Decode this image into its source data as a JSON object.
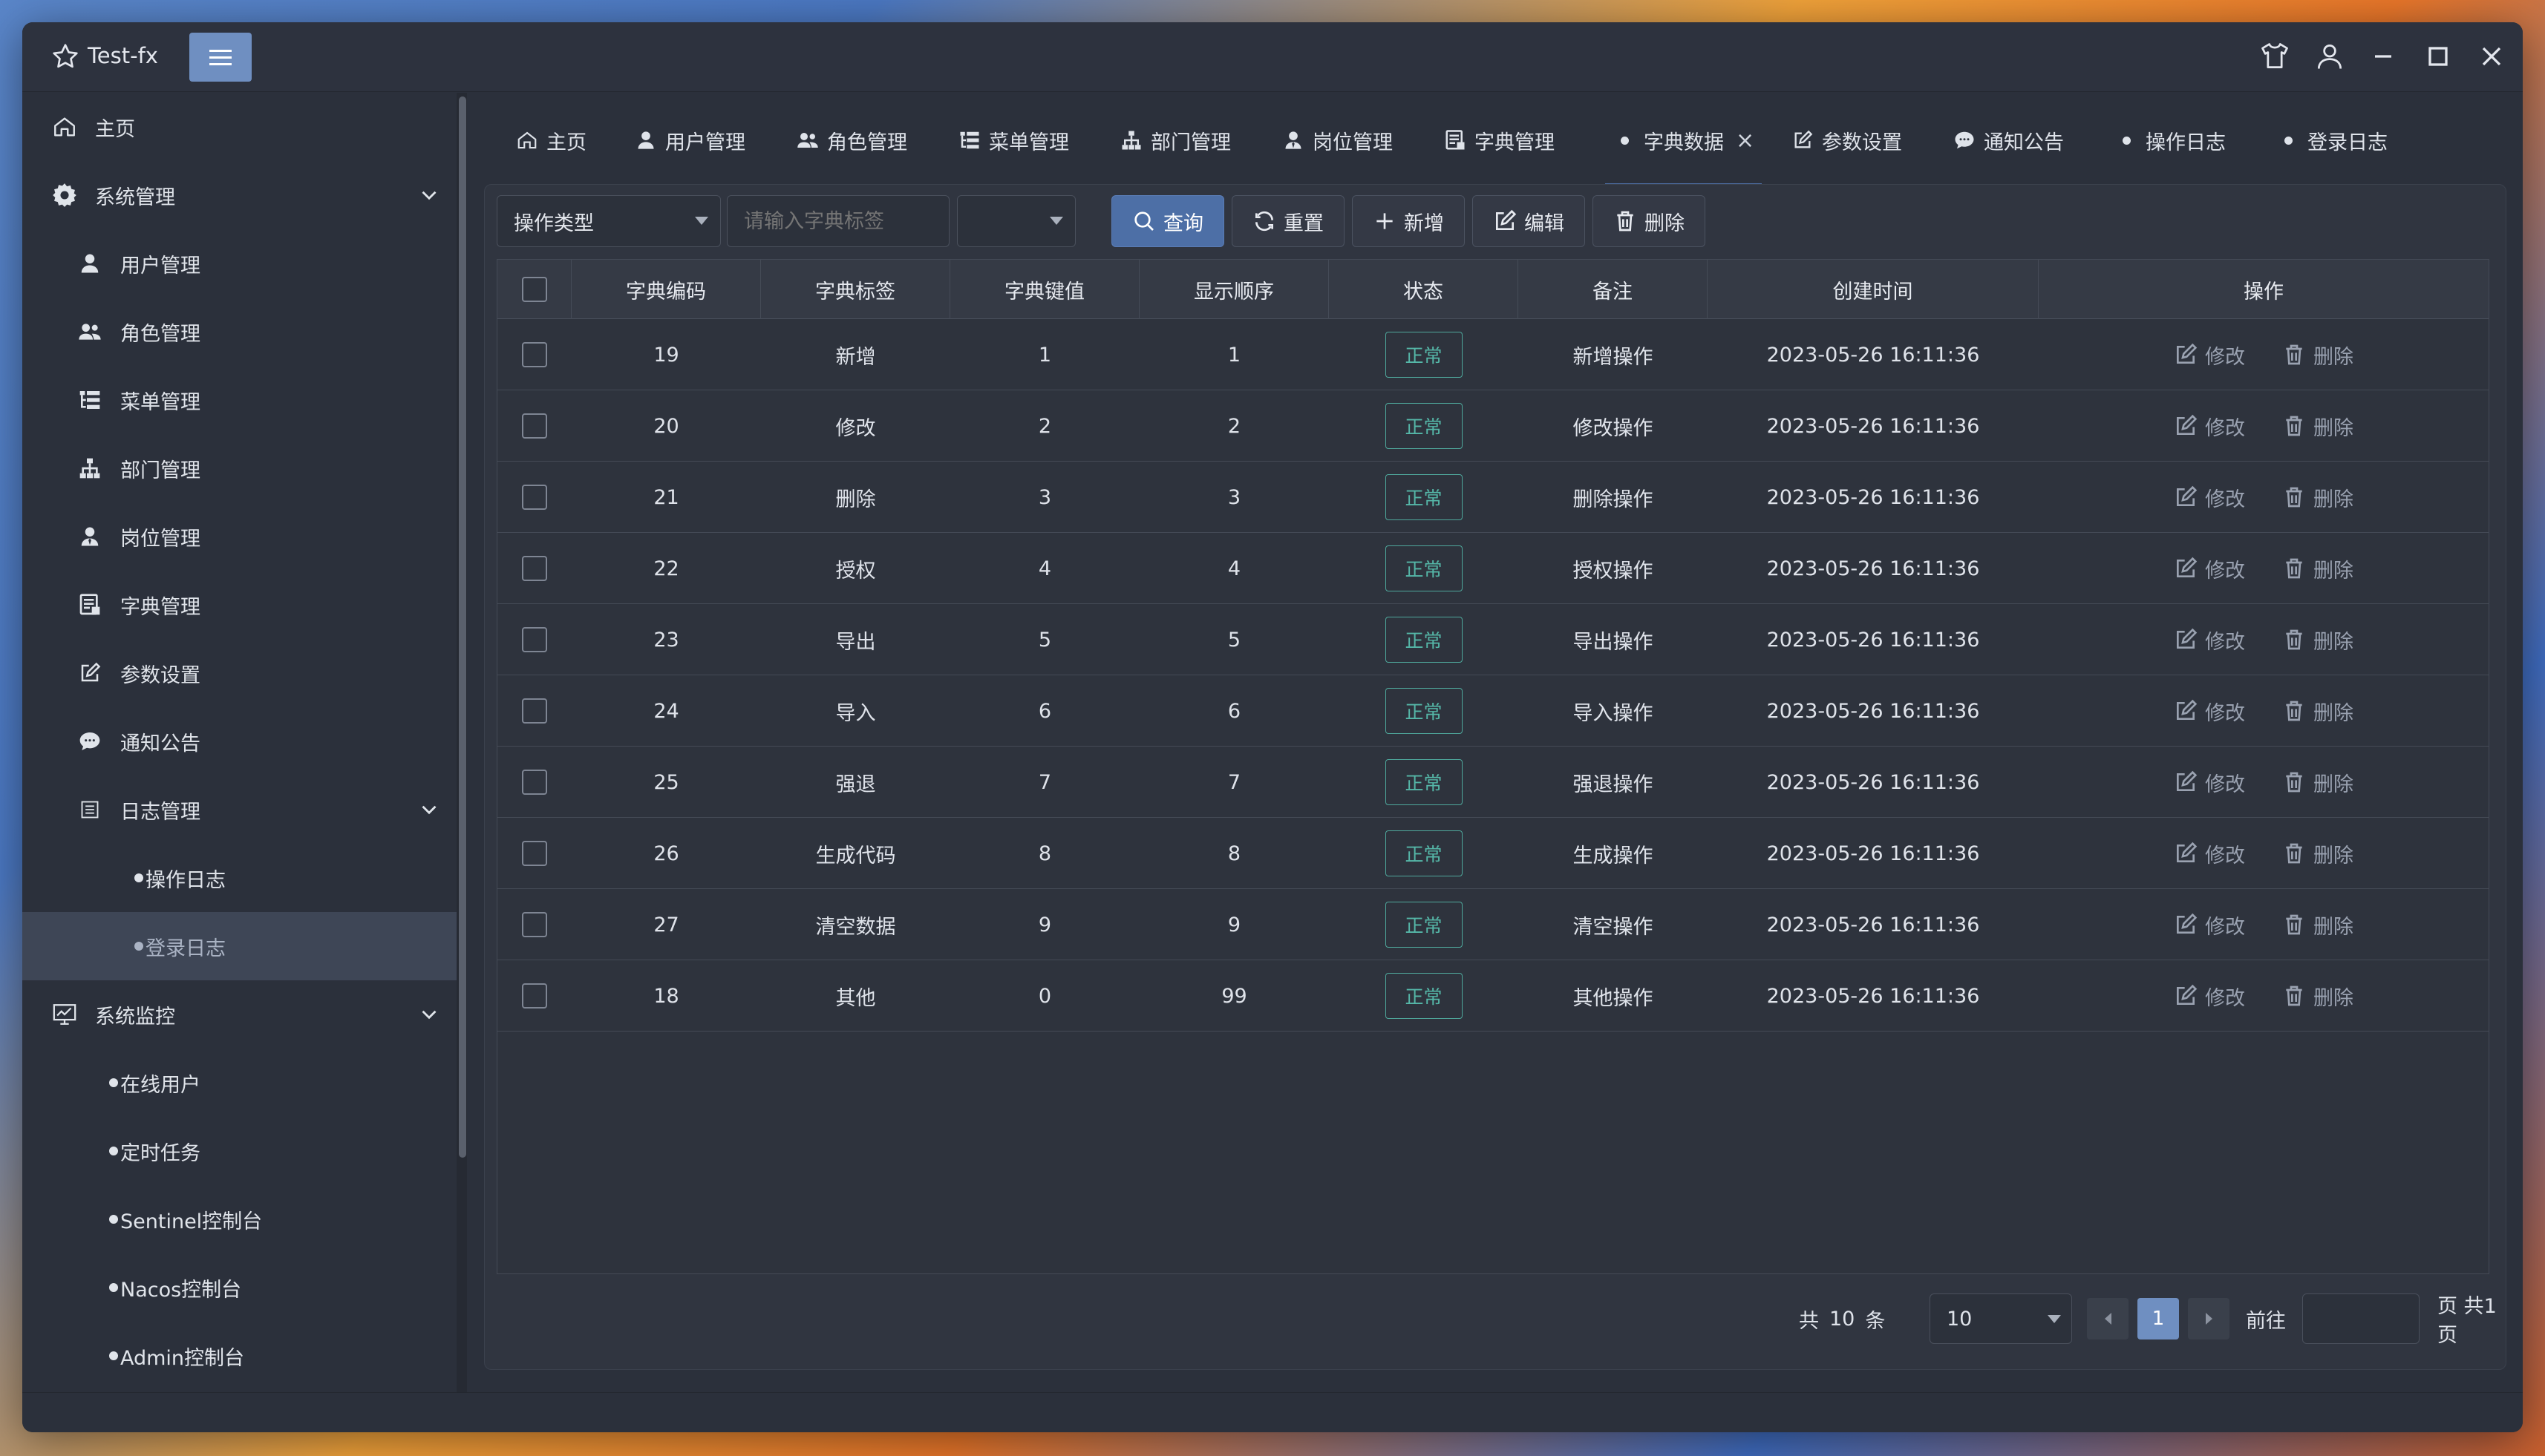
{
  "app": {
    "title": "Test-fx"
  },
  "sidebar": {
    "items": [
      {
        "label": "主页",
        "icon": "home-icon"
      },
      {
        "label": "系统管理",
        "icon": "gear-icon"
      },
      {
        "label": "用户管理",
        "icon": "user-icon"
      },
      {
        "label": "角色管理",
        "icon": "users-icon"
      },
      {
        "label": "菜单管理",
        "icon": "menu-tree-icon"
      },
      {
        "label": "部门管理",
        "icon": "sitemap-icon"
      },
      {
        "label": "岗位管理",
        "icon": "user-tie-icon"
      },
      {
        "label": "字典管理",
        "icon": "dictionary-icon"
      },
      {
        "label": "参数设置",
        "icon": "edit-icon"
      },
      {
        "label": "通知公告",
        "icon": "comment-icon"
      },
      {
        "label": "日志管理",
        "icon": "list-icon"
      },
      {
        "label": "操作日志",
        "icon": "dot-icon"
      },
      {
        "label": "登录日志",
        "icon": "dot-icon"
      },
      {
        "label": "系统监控",
        "icon": "monitor-icon"
      },
      {
        "label": "在线用户",
        "icon": "dot-icon"
      },
      {
        "label": "定时任务",
        "icon": "dot-icon"
      },
      {
        "label": "Sentinel控制台",
        "icon": "dot-icon"
      },
      {
        "label": "Nacos控制台",
        "icon": "dot-icon"
      },
      {
        "label": "Admin控制台",
        "icon": "dot-icon"
      }
    ]
  },
  "tabs": [
    {
      "label": "主页"
    },
    {
      "label": "用户管理"
    },
    {
      "label": "角色管理"
    },
    {
      "label": "菜单管理"
    },
    {
      "label": "部门管理"
    },
    {
      "label": "岗位管理"
    },
    {
      "label": "字典管理"
    },
    {
      "label": "字典数据",
      "close": "×"
    },
    {
      "label": "参数设置"
    },
    {
      "label": "通知公告"
    },
    {
      "label": "操作日志"
    },
    {
      "label": "登录日志"
    }
  ],
  "toolbar": {
    "dict_type_value": "操作类型",
    "label_placeholder": "请输入字典标签",
    "status_value": "",
    "search_label": "查询",
    "reset_label": "重置",
    "add_label": "新增",
    "edit_label": "编辑",
    "delete_label": "删除"
  },
  "table": {
    "headers": [
      "字典编码",
      "字典标签",
      "字典键值",
      "显示顺序",
      "状态",
      "备注",
      "创建时间",
      "操作"
    ],
    "edit_label": "修改",
    "delete_label": "删除",
    "rows": [
      {
        "code": "19",
        "label": "新增",
        "value": "1",
        "order": "1",
        "status": "正常",
        "remark": "新增操作",
        "created": "2023-05-26 16:11:36"
      },
      {
        "code": "20",
        "label": "修改",
        "value": "2",
        "order": "2",
        "status": "正常",
        "remark": "修改操作",
        "created": "2023-05-26 16:11:36"
      },
      {
        "code": "21",
        "label": "删除",
        "value": "3",
        "order": "3",
        "status": "正常",
        "remark": "删除操作",
        "created": "2023-05-26 16:11:36"
      },
      {
        "code": "22",
        "label": "授权",
        "value": "4",
        "order": "4",
        "status": "正常",
        "remark": "授权操作",
        "created": "2023-05-26 16:11:36"
      },
      {
        "code": "23",
        "label": "导出",
        "value": "5",
        "order": "5",
        "status": "正常",
        "remark": "导出操作",
        "created": "2023-05-26 16:11:36"
      },
      {
        "code": "24",
        "label": "导入",
        "value": "6",
        "order": "6",
        "status": "正常",
        "remark": "导入操作",
        "created": "2023-05-26 16:11:36"
      },
      {
        "code": "25",
        "label": "强退",
        "value": "7",
        "order": "7",
        "status": "正常",
        "remark": "强退操作",
        "created": "2023-05-26 16:11:36"
      },
      {
        "code": "26",
        "label": "生成代码",
        "value": "8",
        "order": "8",
        "status": "正常",
        "remark": "生成操作",
        "created": "2023-05-26 16:11:36"
      },
      {
        "code": "27",
        "label": "清空数据",
        "value": "9",
        "order": "9",
        "status": "正常",
        "remark": "清空操作",
        "created": "2023-05-26 16:11:36"
      },
      {
        "code": "18",
        "label": "其他",
        "value": "0",
        "order": "99",
        "status": "正常",
        "remark": "其他操作",
        "created": "2023-05-26 16:11:36"
      }
    ]
  },
  "pagination": {
    "total_prefix": "共",
    "total": "10",
    "total_suffix": "条",
    "page_size": "10",
    "current_page": "1",
    "goto_label": "前往",
    "goto_value": "",
    "page_suffix": "页 共1页"
  },
  "colors": {
    "accent": "#4d6fa6",
    "status_ok": "#55b7a8",
    "background": "#2b303b"
  }
}
